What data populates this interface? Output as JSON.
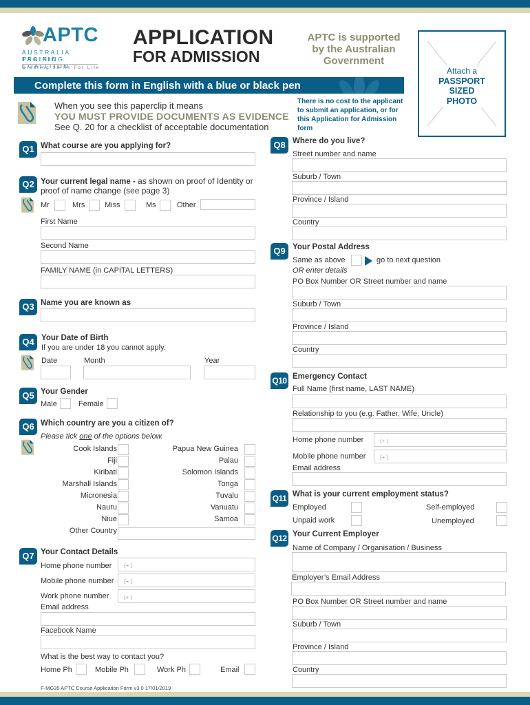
{
  "header": {
    "logo": {
      "name": "APTC",
      "subline1": "AUSTRALIA PACIFIC",
      "subline2": "TRAINING COALITION",
      "tagline": "Creating Skills For Life"
    },
    "title_line1": "APPLICATION",
    "title_line2": "FOR ADMISSION",
    "support_line1": "APTC is supported",
    "support_line2": "by the Australian",
    "support_line3": "Government",
    "photo": {
      "line1": "Attach a",
      "line2": "PASSPORT",
      "line3": "SIZED",
      "line4": "PHOTO"
    }
  },
  "banner": "Complete this form in English with a blue or black pen",
  "evidence_note": {
    "line1": "When you see this paperclip it means",
    "line2": "YOU MUST PROVIDE DOCUMENTS AS EVIDENCE",
    "line3": "See Q. 20 for a checklist of acceptable documentation"
  },
  "cost_note": {
    "line1": "There is no cost to the applicant",
    "line2": "to submit an application, or for",
    "line3": "this Application for Admission",
    "line4": "form"
  },
  "questions": {
    "q1": {
      "num": "Q1",
      "title": "What course are you applying for?",
      "value": ""
    },
    "q2": {
      "num": "Q2",
      "title_bold": "Your current legal name -",
      "title_rest": " as shown on proof of Identity or",
      "title_line2": "proof of name change (see page 3)",
      "titles": [
        "Mr",
        "Mrs",
        "Miss",
        "Ms",
        "Other"
      ],
      "first_name": "First Name",
      "second_name": "Second Name",
      "family_name": "FAMILY NAME (in CAPITAL LETTERS)"
    },
    "q3": {
      "num": "Q3",
      "title": "Name you are known as"
    },
    "q4": {
      "num": "Q4",
      "title": "Your Date of Birth",
      "subtitle": "If you are under 18 you cannot apply.",
      "date": "Date",
      "month": "Month",
      "year": "Year"
    },
    "q5": {
      "num": "Q5",
      "title": "Your Gender",
      "male": "Male",
      "female": "Female"
    },
    "q6": {
      "num": "Q6",
      "title": "Which country are you a citizen of?",
      "instr_pre": "Please tick ",
      "instr_u": "one",
      "instr_post": " of the options below.",
      "left": [
        "Cook Islands",
        "Fiji",
        "Kiribati",
        "Marshall Islands",
        "Micronesia",
        "Nauru",
        "Niue"
      ],
      "right": [
        "Papua New Guinea",
        "Palau",
        "Solomon Islands",
        "Tonga",
        "Tuvalu",
        "Vanuatu",
        "Samoa"
      ],
      "other": "Other Country"
    },
    "q7": {
      "num": "Q7",
      "title": "Your Contact Details",
      "home_phone": "Home phone number",
      "mobile_phone": "Mobile phone number",
      "work_phone": "Work phone number",
      "phone_placeholder": "(+        )",
      "email": "Email address",
      "facebook": "Facebook Name",
      "best_way": "What is the best way to contact you?",
      "options": [
        "Home Ph",
        "Mobile Ph",
        "Work Ph",
        "Email"
      ]
    },
    "q8": {
      "num": "Q8",
      "title": "Where do you live?",
      "street": "Street number and name",
      "suburb": "Suburb / Town",
      "province": "Province / Island",
      "country": "Country"
    },
    "q9": {
      "num": "Q9",
      "title": "Your Postal Address",
      "same": "Same as above",
      "goto": "go to next question",
      "or": "OR enter details",
      "pobox": "PO Box Number OR Street number and name",
      "suburb": "Suburb / Town",
      "province": "Province / Island",
      "country": "Country"
    },
    "q10": {
      "num": "Q10",
      "title": "Emergency Contact",
      "full_name": "Full Name (first name, LAST NAME)",
      "relationship": "Relationship to you (e.g. Father, Wife, Uncle)",
      "home_phone": "Home phone number",
      "mobile_phone": "Mobile phone number",
      "phone_placeholder": "(+        )",
      "email": "Email address"
    },
    "q11": {
      "num": "Q11",
      "title": "What is your current employment status?",
      "employed": "Employed",
      "self_employed": "Self-employed",
      "unpaid": "Unpaid work",
      "unemployed": "Unemployed"
    },
    "q12": {
      "num": "Q12",
      "title": "Your Current Employer",
      "company": "Name of Company / Organisation / Business",
      "email": "Employer’s Email Address",
      "pobox": "PO Box Number OR Street number and name",
      "suburb": "Suburb / Town",
      "province": "Province / Island",
      "country": "Country"
    }
  },
  "footer": "F-MG35 APTC Course Application Form v3.0 17/01/2019",
  "colors": {
    "brand_teal": "#0a5d86",
    "tan": "#ddd6b4",
    "olive_text": "#8d8d72"
  }
}
